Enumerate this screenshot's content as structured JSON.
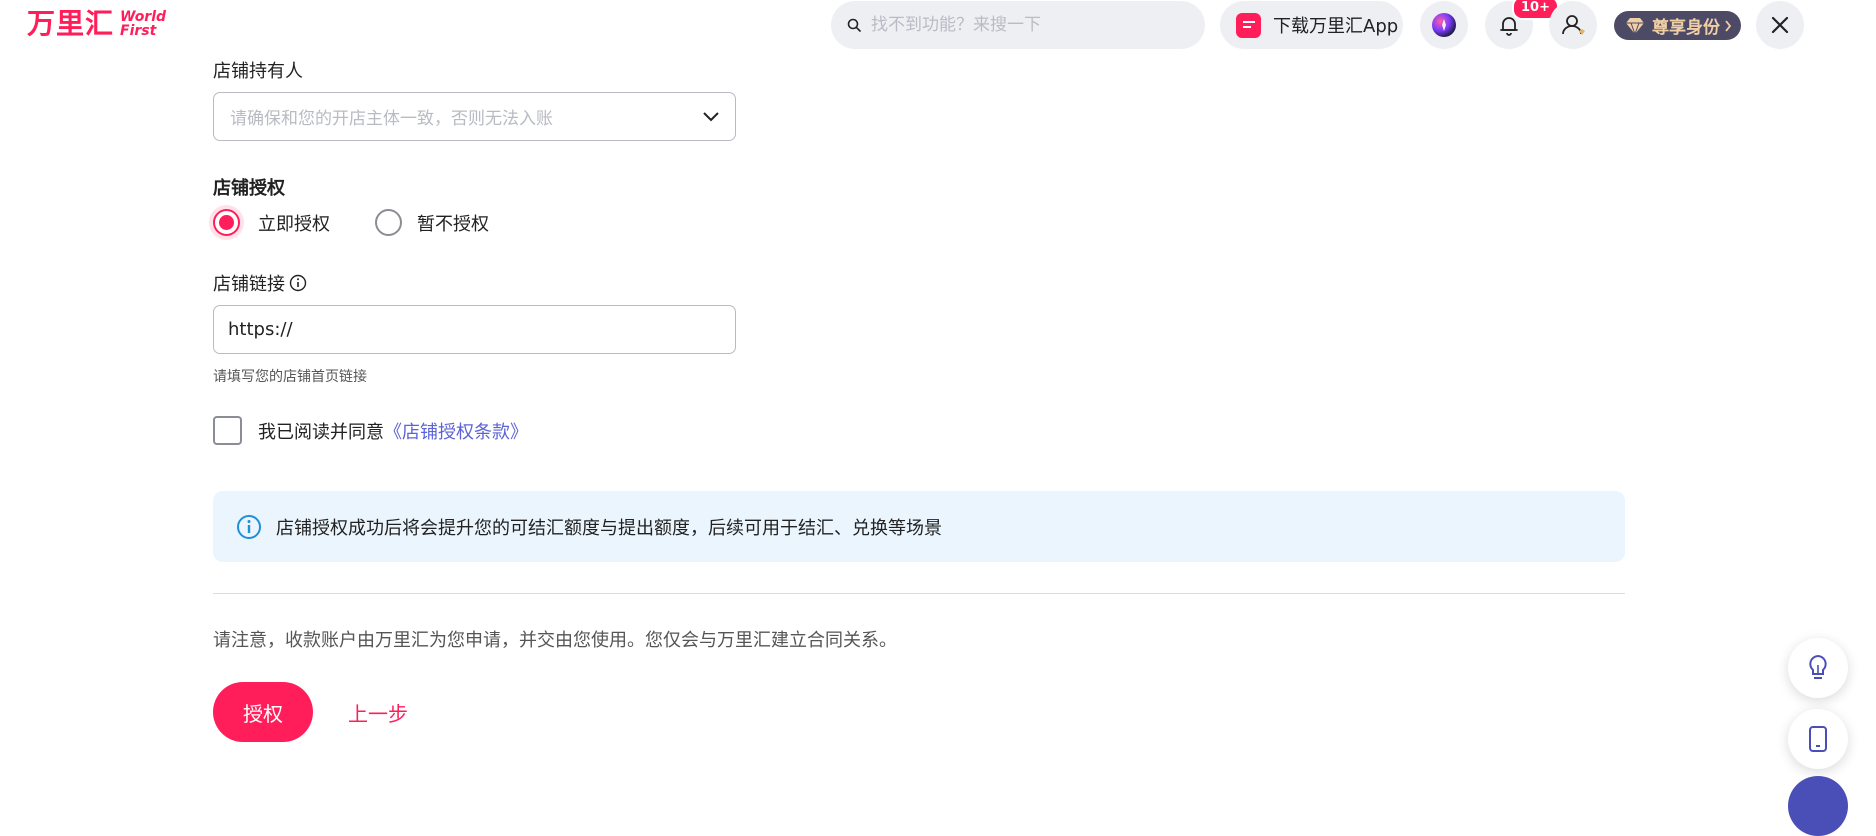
{
  "header": {
    "logo_cn": "万里汇",
    "logo_en_1": "World",
    "logo_en_2": "First",
    "search_placeholder": "找不到功能？来搜一下",
    "download_app_label": "下载万里汇App",
    "notification_badge": "10+",
    "vip_label": "尊享身份"
  },
  "form": {
    "store_owner": {
      "label": "店铺持有人",
      "placeholder": "请确保和您的开店主体一致，否则无法入账"
    },
    "authorization": {
      "label": "店铺授权",
      "options": [
        {
          "label": "立即授权",
          "selected": true
        },
        {
          "label": "暂不授权",
          "selected": false
        }
      ]
    },
    "store_link": {
      "label": "店铺链接",
      "value": "https://",
      "hint": "请填写您的店铺首页链接"
    },
    "agreement": {
      "prefix": "我已阅读并同意",
      "link": "《店铺授权条款》"
    }
  },
  "info_box": {
    "text": "店铺授权成功后将会提升您的可结汇额度与提出额度，后续可用于结汇、兑换等场景"
  },
  "notice": "请注意，收款账户由万里汇为您申请，并交由您使用。您仅会与万里汇建立合同关系。",
  "actions": {
    "primary": "授权",
    "back": "上一步"
  },
  "colors": {
    "brand": "#ff1e5a",
    "link": "#5c63d6",
    "info_bg": "#eaf5fd",
    "info_icon": "#1f8fd6",
    "vip_bg": "#4d4a66"
  }
}
